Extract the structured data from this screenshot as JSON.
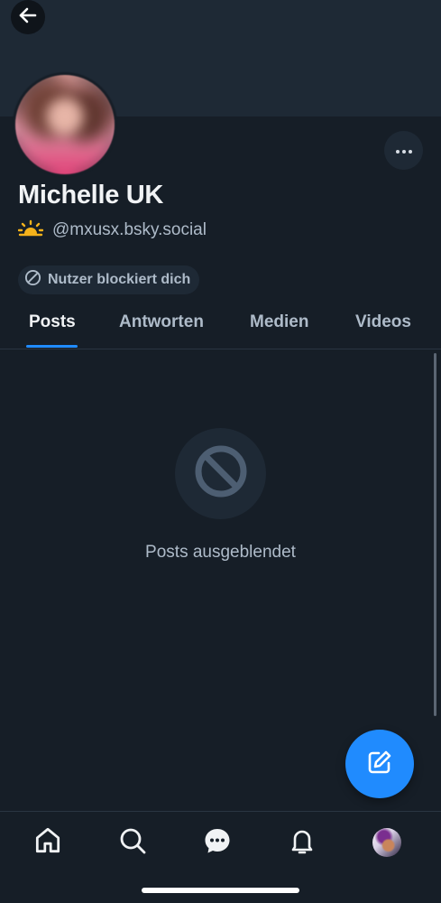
{
  "profile": {
    "display_name": "Michelle UK",
    "handle": "@mxusx.bsky.social",
    "blocked_label": "Nutzer blockiert dich"
  },
  "tabs": [
    {
      "label": "Posts",
      "active": true
    },
    {
      "label": "Antworten",
      "active": false
    },
    {
      "label": "Medien",
      "active": false
    },
    {
      "label": "Videos",
      "active": false
    }
  ],
  "empty_state": {
    "message": "Posts ausgeblendet"
  },
  "colors": {
    "background": "#161e27",
    "banner": "#1e2935",
    "accent": "#208bfe",
    "muted_text": "#aebbc9"
  },
  "icons": {
    "back": "arrow-left-icon",
    "more": "ellipsis-icon",
    "handle_badge": "sunrise-icon",
    "blocked": "block-icon",
    "compose": "compose-icon",
    "nav": [
      "home-icon",
      "search-icon",
      "chat-icon",
      "bell-icon",
      "profile-avatar"
    ]
  }
}
